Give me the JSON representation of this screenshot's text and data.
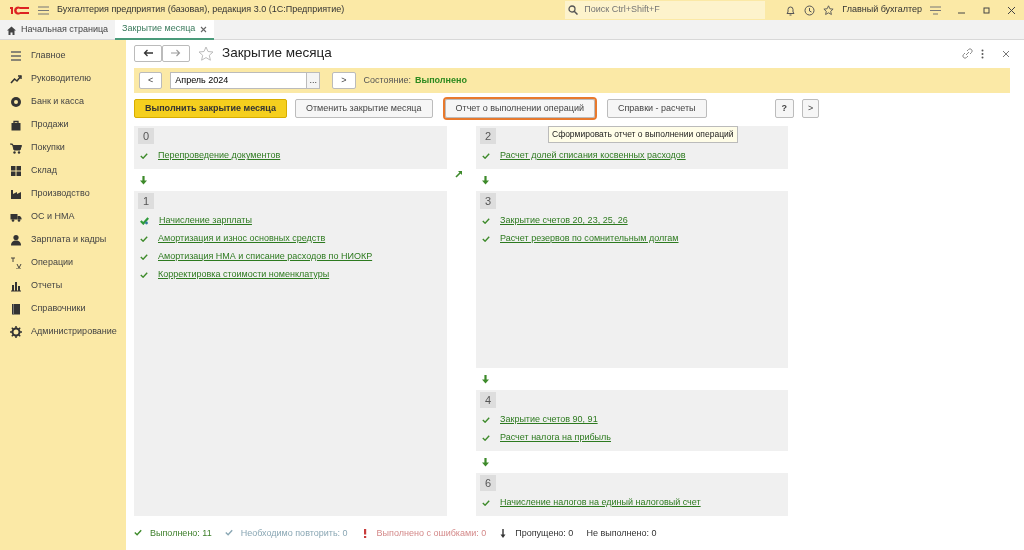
{
  "app_bar": {
    "title": "Бухгалтерия предприятия (базовая), редакция 3.0  (1С:Предприятие)",
    "search": {
      "placeholder": "Поиск Ctrl+Shift+F"
    },
    "user": "Главный бухгалтер"
  },
  "tabs": [
    {
      "label": "Начальная страница",
      "kind": "home",
      "selected": false
    },
    {
      "label": "Закрытие месяца",
      "kind": "doc",
      "selected": true
    }
  ],
  "sidebar": {
    "items": [
      {
        "label": "Главное"
      },
      {
        "label": "Руководителю"
      },
      {
        "label": "Банк и касса"
      },
      {
        "label": "Продажи"
      },
      {
        "label": "Покупки"
      },
      {
        "label": "Склад"
      },
      {
        "label": "Производство"
      },
      {
        "label": "ОС и НМА"
      },
      {
        "label": "Зарплата и кадры"
      },
      {
        "label": "Операции"
      },
      {
        "label": "Отчеты"
      },
      {
        "label": "Справочники"
      },
      {
        "label": "Администрирование"
      }
    ]
  },
  "form": {
    "title": "Закрытие месяца",
    "period": {
      "prev": "<",
      "value": "Апрель 2024",
      "choose": "...",
      "next": ">",
      "state_label": "Состояние:",
      "state": "Выполнено"
    },
    "buttons": [
      {
        "label": "Выполнить закрытие месяца",
        "kind": "primary",
        "highlighted": false
      },
      {
        "label": "Отменить закрытие месяца",
        "kind": "normal",
        "highlighted": false
      },
      {
        "label": "Отчет о выполнении операций",
        "kind": "normal",
        "highlighted": true
      },
      {
        "label": "Справки - расчеты",
        "kind": "normal",
        "highlighted": false
      }
    ],
    "help_button": "?",
    "more_button": ">",
    "tooltip": "Сформировать отчет о выполнении операций",
    "columns": [
      [
        {
          "number": "0",
          "operations": [
            {
              "label": "Перепроведение документов",
              "kind": "done"
            }
          ]
        },
        {
          "number": "1",
          "operations": [
            {
              "label": "Начисление зарплаты",
              "kind": "done_external"
            },
            {
              "label": "Амортизация и износ основных средств",
              "kind": "done"
            },
            {
              "label": "Амортизация НМА и списание расходов по НИОКР",
              "kind": "done"
            },
            {
              "label": "Корректировка стоимости номенклатуры",
              "kind": "done"
            }
          ]
        }
      ],
      [
        {
          "number": "2",
          "operations": [
            {
              "label": "Расчет долей списания косвенных расходов",
              "kind": "done"
            }
          ]
        },
        {
          "number": "3",
          "operations": [
            {
              "label": "Закрытие счетов 20, 23, 25, 26",
              "kind": "done"
            },
            {
              "label": "Расчет резервов по сомнительным долгам",
              "kind": "done"
            }
          ]
        },
        {
          "number": "4",
          "operations": [
            {
              "label": "Закрытие счетов 90, 91",
              "kind": "done"
            },
            {
              "label": "Расчет налога на прибыль",
              "kind": "done"
            }
          ]
        },
        {
          "number": "6",
          "operations": [
            {
              "label": "Начисление налогов на единый налоговый счет",
              "kind": "done"
            }
          ]
        }
      ]
    ],
    "legend": [
      {
        "label": "Выполнено: 11",
        "kind": "done"
      },
      {
        "label": "Необходимо повторить: 0",
        "kind": "repeat"
      },
      {
        "label": "Выполнено с ошибками: 0",
        "kind": "error"
      },
      {
        "label": "Пропущено: 0",
        "kind": "skipped"
      },
      {
        "label": "Не выполнено: 0",
        "kind": "none"
      }
    ]
  }
}
